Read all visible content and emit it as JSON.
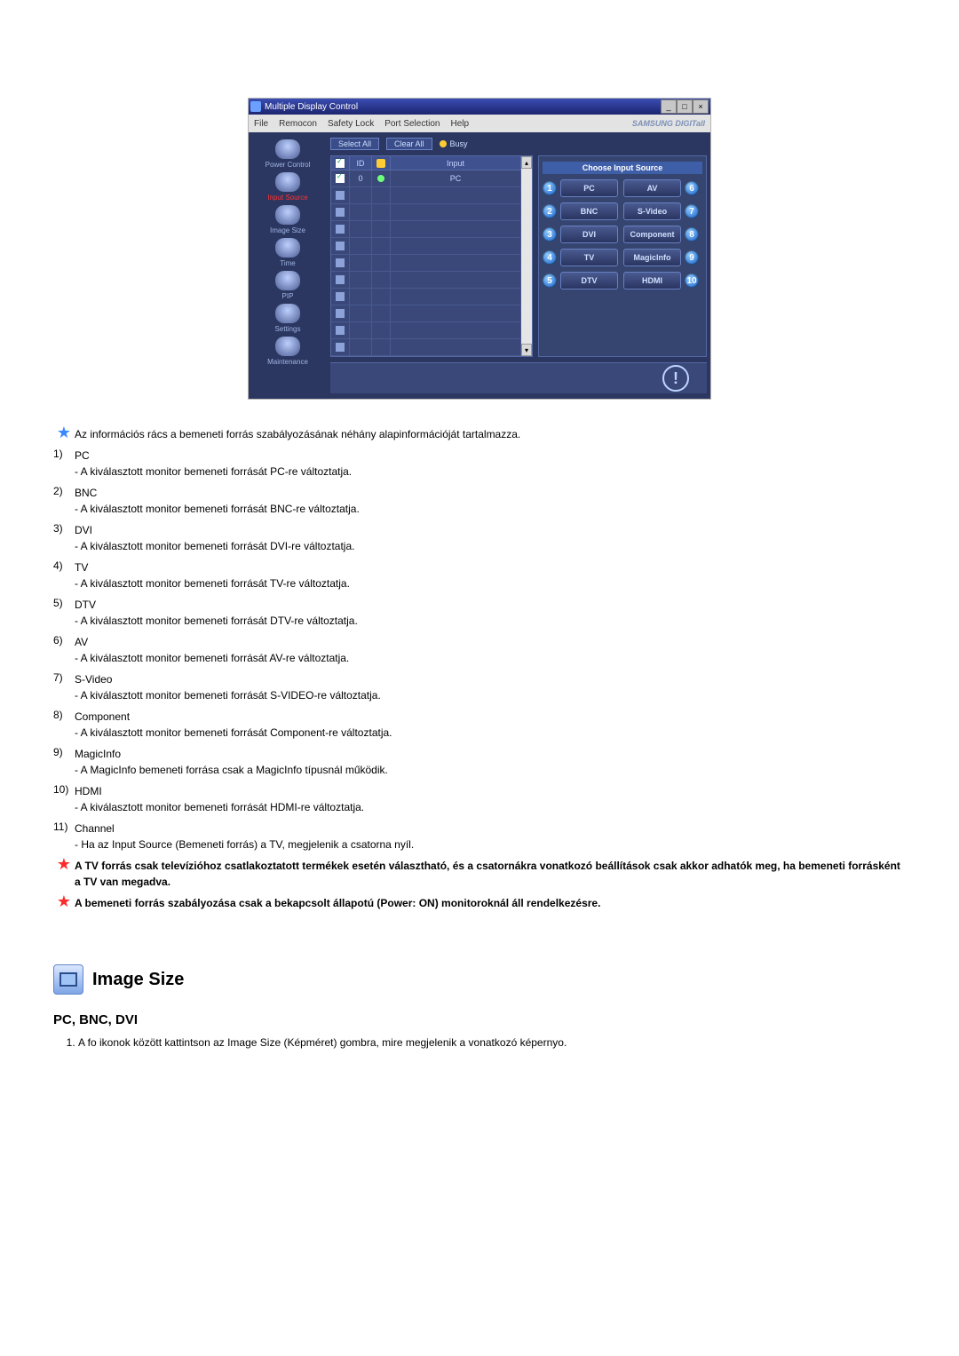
{
  "app": {
    "title": "Multiple Display Control",
    "menu": [
      "File",
      "Remocon",
      "Safety Lock",
      "Port Selection",
      "Help"
    ],
    "brand": "SAMSUNG DIGITall"
  },
  "sidebar": {
    "items": [
      {
        "label": "Power Control"
      },
      {
        "label": "Input Source"
      },
      {
        "label": "Image Size"
      },
      {
        "label": "Time"
      },
      {
        "label": "PIP"
      },
      {
        "label": "Settings"
      },
      {
        "label": "Maintenance"
      }
    ]
  },
  "toolbar": {
    "select_all": "Select All",
    "clear_all": "Clear All",
    "busy": "Busy"
  },
  "table": {
    "headers": {
      "chk": "",
      "id": "ID",
      "status": "",
      "input": "Input"
    },
    "rows": [
      {
        "checked": true,
        "id": "0",
        "status": "on",
        "input": "PC"
      },
      {
        "checked": false,
        "id": "",
        "status": "",
        "input": ""
      },
      {
        "checked": false,
        "id": "",
        "status": "",
        "input": ""
      },
      {
        "checked": false,
        "id": "",
        "status": "",
        "input": ""
      },
      {
        "checked": false,
        "id": "",
        "status": "",
        "input": ""
      },
      {
        "checked": false,
        "id": "",
        "status": "",
        "input": ""
      },
      {
        "checked": false,
        "id": "",
        "status": "",
        "input": ""
      },
      {
        "checked": false,
        "id": "",
        "status": "",
        "input": ""
      },
      {
        "checked": false,
        "id": "",
        "status": "",
        "input": ""
      },
      {
        "checked": false,
        "id": "",
        "status": "",
        "input": ""
      },
      {
        "checked": false,
        "id": "",
        "status": "",
        "input": ""
      }
    ]
  },
  "panel": {
    "header": "Choose Input Source",
    "left": [
      {
        "n": "1",
        "label": "PC"
      },
      {
        "n": "2",
        "label": "BNC"
      },
      {
        "n": "3",
        "label": "DVI"
      },
      {
        "n": "4",
        "label": "TV"
      },
      {
        "n": "5",
        "label": "DTV"
      }
    ],
    "right": [
      {
        "n": "6",
        "label": "AV"
      },
      {
        "n": "7",
        "label": "S-Video"
      },
      {
        "n": "8",
        "label": "Component"
      },
      {
        "n": "9",
        "label": "MagicInfo"
      },
      {
        "n": "10",
        "label": "HDMI"
      }
    ]
  },
  "desc": {
    "intro": "Az információs rács a bemeneti forrás szabályozásának néhány alapinformációját tartalmazza.",
    "items": [
      {
        "n": "1)",
        "title": "PC",
        "sub": "- A kiválasztott monitor bemeneti forrását PC-re változtatja."
      },
      {
        "n": "2)",
        "title": "BNC",
        "sub": "- A kiválasztott monitor bemeneti forrását BNC-re változtatja."
      },
      {
        "n": "3)",
        "title": "DVI",
        "sub": "- A kiválasztott monitor bemeneti forrását DVI-re változtatja."
      },
      {
        "n": "4)",
        "title": "TV",
        "sub": "- A kiválasztott monitor bemeneti forrását TV-re változtatja."
      },
      {
        "n": "5)",
        "title": "DTV",
        "sub": "- A kiválasztott monitor bemeneti forrását DTV-re változtatja."
      },
      {
        "n": "6)",
        "title": "AV",
        "sub": "- A kiválasztott monitor bemeneti forrását AV-re változtatja."
      },
      {
        "n": "7)",
        "title": "S-Video",
        "sub": "- A kiválasztott monitor bemeneti forrását S-VIDEO-re változtatja."
      },
      {
        "n": "8)",
        "title": "Component",
        "sub": "- A kiválasztott monitor bemeneti forrását Component-re változtatja."
      },
      {
        "n": "9)",
        "title": "MagicInfo",
        "sub": "- A MagicInfo bemeneti forrása csak a MagicInfo típusnál működik."
      },
      {
        "n": "10)",
        "title": "HDMI",
        "sub": "- A kiválasztott monitor bemeneti forrását HDMI-re változtatja."
      },
      {
        "n": "11)",
        "title": "Channel",
        "sub": "- Ha az Input Source (Bemeneti forrás) a TV, megjelenik a csatorna nyíl."
      }
    ],
    "note1": "A TV forrás csak televízióhoz csatlakoztatott termékek esetén választható, és a csatornákra vonatkozó beállítások csak akkor adhatók meg, ha bemeneti forrásként a TV van megadva.",
    "note2": "A bemeneti forrás szabályozása csak a bekapcsolt állapotú (Power: ON) monitoroknál áll rendelkezésre."
  },
  "section": {
    "heading": "Image Size",
    "subheading": "PC, BNC, DVI",
    "step1": "A fo ikonok között kattintson az Image Size (Képméret) gombra, mire megjelenik a vonatkozó képernyo."
  }
}
